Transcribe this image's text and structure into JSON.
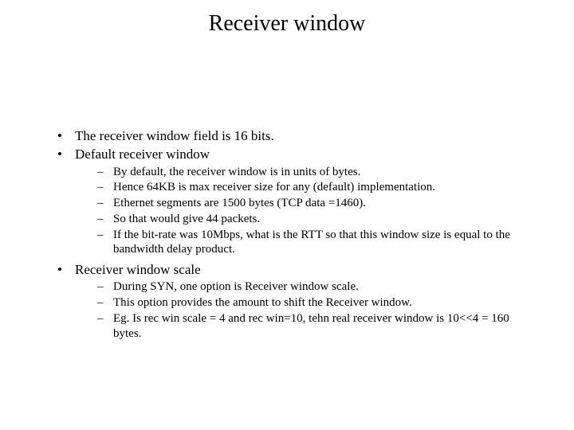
{
  "title": "Receiver window",
  "bullets": {
    "b1": "The receiver window field is 16 bits.",
    "b2": "Default receiver window",
    "b2subs": {
      "s1": "By default, the receiver window is in units of bytes.",
      "s2": "Hence 64KB is max receiver size for any (default) implementation.",
      "s3": "Ethernet segments are 1500 bytes (TCP data =1460).",
      "s4": "So that would give 44 packets.",
      "s5": "If the bit-rate was 10Mbps, what is the RTT so that this window size is equal to the bandwidth delay product."
    },
    "b3": "Receiver window scale",
    "b3subs": {
      "s1": "During SYN, one option is Receiver window scale.",
      "s2": "This option provides the amount to shift the Receiver window.",
      "s3": "Eg. Is rec win scale = 4 and rec win=10, tehn real receiver window is 10<<4 = 160 bytes."
    }
  }
}
